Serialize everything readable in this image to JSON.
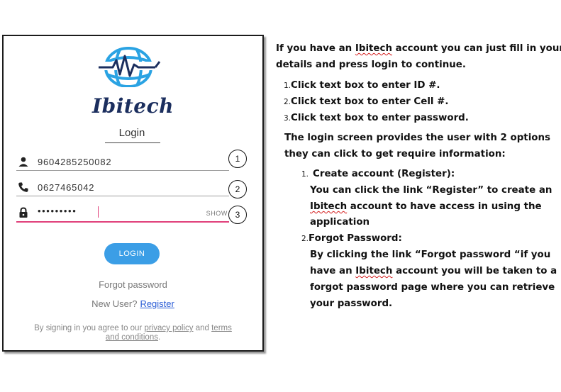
{
  "app": {
    "brand": "Ibitech",
    "title": "Login",
    "fields": [
      {
        "id": "id",
        "icon": "user-icon",
        "value": "9604285250082",
        "marker": "1"
      },
      {
        "id": "cell",
        "icon": "phone-icon",
        "value": "0627465042",
        "marker": "2"
      },
      {
        "id": "password",
        "icon": "lock-icon",
        "value": "•••••••••",
        "show_label": "SHOW",
        "marker": "3"
      }
    ],
    "login_button": "LOGIN",
    "forgot_password": "Forgot password",
    "new_user": "New User?",
    "register": "Register",
    "terms_prefix": "By signing in you agree to our",
    "privacy_policy": "privacy policy",
    "and": "and",
    "terms_line1": "terms",
    "terms_line2": "and conditions",
    "terms_end": ".",
    "colors": {
      "primary": "#3b9ee6",
      "brand_text": "#1b2e5e",
      "active_underline": "#e0407a",
      "link": "#2a5cd6"
    }
  },
  "instructions": {
    "intro_a": "If you have an ",
    "intro_word": "Ibitech",
    "intro_b": " account you can just fill in your",
    "intro_line2": "details and press login to continue.",
    "steps": [
      {
        "n": "1.",
        "text": "Click text box to enter ID #."
      },
      {
        "n": "2.",
        "text": "Click text box to enter Cell #."
      },
      {
        "n": "3.",
        "text": "Click text box to enter password."
      }
    ],
    "options_line1": "The login screen provides the user with 2 options",
    "options_line2": "they can click to get require information:",
    "opt1_n": "1.",
    "opt1_title": "Create account (Register):",
    "opt1_line1": "You can click the link “Register” to create an",
    "opt1_word": "Ibitech",
    "opt1_line2_rest": " account to have access in using the",
    "opt1_line3": "application",
    "opt2_n": "2.",
    "opt2_title": "Forgot Password:",
    "opt2_line1": "By clicking the link “Forgot password “if you",
    "opt2_line2_a": "have an ",
    "opt2_word": "Ibitech",
    "opt2_line2_b": " account you will be taken to a",
    "opt2_line3": "forgot password page where you can retrieve",
    "opt2_line4": "your password."
  }
}
